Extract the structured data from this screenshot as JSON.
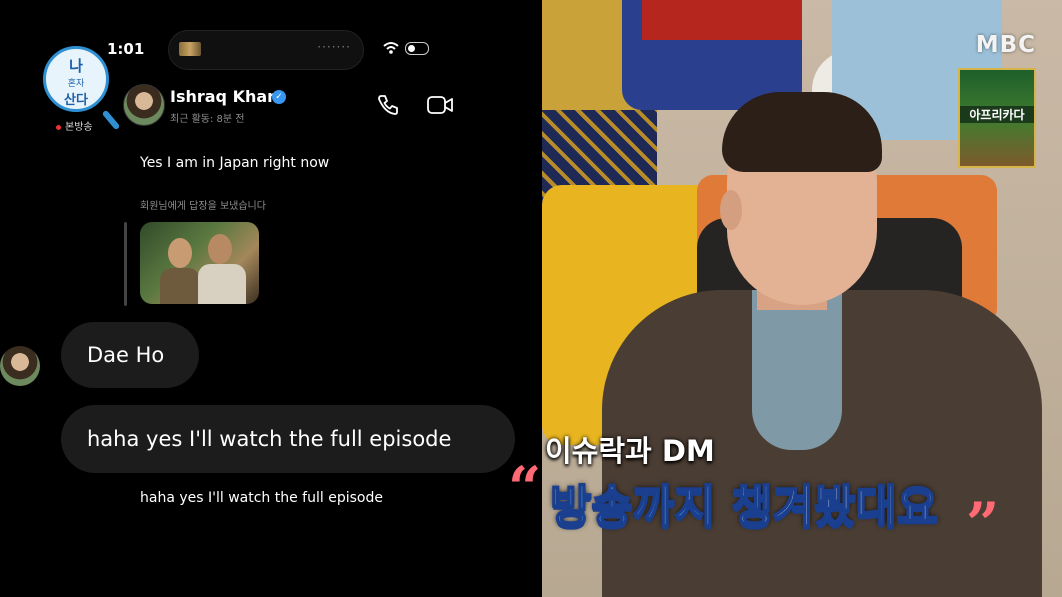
{
  "status_bar": {
    "time": "1:01"
  },
  "show_logo": {
    "line1": "나",
    "line2": "혼자",
    "line3": "산다",
    "live_label": "본방송"
  },
  "dm_header": {
    "name": "Ishraq Khan",
    "activity": "최근 활동: 8분 전"
  },
  "messages": {
    "reply_quote_text": "Yes I am in Japan right now",
    "reply_note": "회원님에게 답장을 보냈습니다",
    "bubble_name": "Dae Ho",
    "bubble_message": "haha yes I'll watch the full episode",
    "echo_text": "haha yes I'll watch the full episode"
  },
  "broadcast": {
    "channel_logo": "MBC",
    "badge_text": "아프리카다",
    "caption_top": "이슈락과 DM",
    "caption_main_highlight": "방송까지",
    "caption_main_rest": " 챙겨봤대요",
    "quote_open": "“",
    "quote_close": "”"
  },
  "colors": {
    "verified": "#3897f0",
    "bubble_bg": "#1c1c1d",
    "caption_quote": "#ff6a75",
    "caption_highlight": "#7fd3ff"
  },
  "icons": [
    "call-icon",
    "video-call-icon",
    "verified-badge-icon",
    "wifi-icon",
    "battery-icon"
  ]
}
